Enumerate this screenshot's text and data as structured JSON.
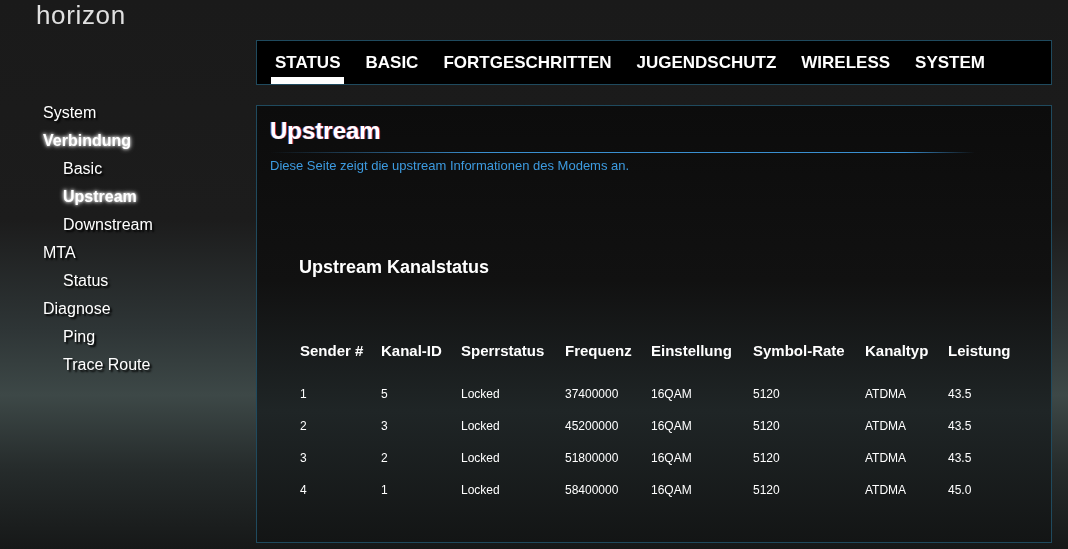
{
  "logo": "horizon",
  "nav_tabs": [
    {
      "label": "STATUS",
      "selected": true
    },
    {
      "label": "BASIC",
      "selected": false
    },
    {
      "label": "FORTGESCHRITTEN",
      "selected": false
    },
    {
      "label": "JUGENDSCHUTZ",
      "selected": false
    },
    {
      "label": "WIRELESS",
      "selected": false
    },
    {
      "label": "SYSTEM",
      "selected": false
    }
  ],
  "sidebar": {
    "items": [
      {
        "label": "System",
        "selected": false
      },
      {
        "label": "Verbindung",
        "selected": true,
        "children": [
          {
            "label": "Basic",
            "selected": false
          },
          {
            "label": "Upstream",
            "selected": true
          },
          {
            "label": "Downstream",
            "selected": false
          }
        ]
      },
      {
        "label": "MTA",
        "selected": false,
        "children": [
          {
            "label": "Status",
            "selected": false
          }
        ]
      },
      {
        "label": "Diagnose",
        "selected": false,
        "children": [
          {
            "label": "Ping",
            "selected": false
          },
          {
            "label": "Trace Route",
            "selected": false
          }
        ]
      }
    ]
  },
  "page": {
    "title": "Upstream",
    "description": "Diese Seite zeigt die upstream Informationen des Modems an.",
    "section_title": "Upstream Kanalstatus"
  },
  "table": {
    "columns": [
      "Sender #",
      "Kanal-ID",
      "Sperrstatus",
      "Frequenz",
      "Einstellung",
      "Symbol-Rate",
      "Kanaltyp",
      "Leistung"
    ],
    "rows": [
      [
        "1",
        "5",
        "Locked",
        "37400000",
        "16QAM",
        "5120",
        "ATDMA",
        "43.5"
      ],
      [
        "2",
        "3",
        "Locked",
        "45200000",
        "16QAM",
        "5120",
        "ATDMA",
        "43.5"
      ],
      [
        "3",
        "2",
        "Locked",
        "51800000",
        "16QAM",
        "5120",
        "ATDMA",
        "43.5"
      ],
      [
        "4",
        "1",
        "Locked",
        "58400000",
        "16QAM",
        "5120",
        "ATDMA",
        "45.0"
      ]
    ]
  }
}
